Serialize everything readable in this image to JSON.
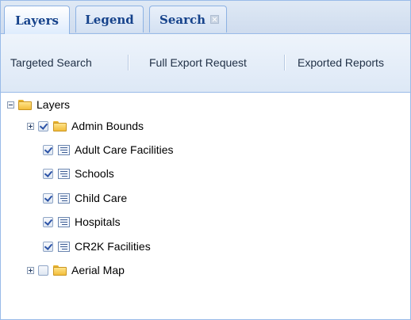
{
  "tabs": [
    {
      "label": "Layers",
      "active": true
    },
    {
      "label": "Legend",
      "active": false
    },
    {
      "label": "Search",
      "active": false,
      "closable": true
    }
  ],
  "toolbar": {
    "targeted_search": "Targeted Search",
    "full_export_request": "Full Export Request",
    "exported_reports": "Exported Reports"
  },
  "tree": {
    "root": {
      "label": "Layers",
      "expanded": true,
      "icon": "folder-icon"
    },
    "nodes": [
      {
        "label": "Admin Bounds",
        "checked": true,
        "icon": "folder-icon",
        "expandable": true
      },
      {
        "label": "Adult Care Facilities",
        "checked": true,
        "icon": "layer-icon"
      },
      {
        "label": "Schools",
        "checked": true,
        "icon": "layer-icon"
      },
      {
        "label": "Child Care",
        "checked": true,
        "icon": "layer-icon"
      },
      {
        "label": "Hospitals",
        "checked": true,
        "icon": "layer-icon"
      },
      {
        "label": "CR2K Facilities",
        "checked": true,
        "icon": "layer-icon"
      },
      {
        "label": "Aerial Map",
        "checked": false,
        "icon": "folder-icon",
        "expandable": true
      }
    ]
  },
  "colors": {
    "tab_text": "#15428b",
    "border": "#99bbe8",
    "check": "#2b52a6",
    "folder": "#f2bd3b"
  }
}
